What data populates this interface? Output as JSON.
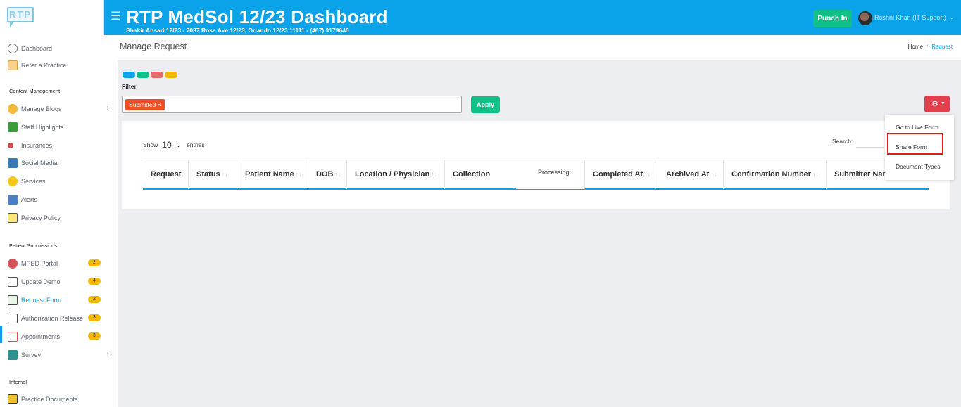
{
  "app": {
    "logo_text": "RTP",
    "title": "RTP MedSol 12/23 Dashboard",
    "subtitle": "Shakir Ansari 12/23 - 7037 Rose Ave 12/23, Orlando 12/23 11111 - (407) 9179646",
    "punch_in_label": "Punch In",
    "user_name": "Roshni Khan (IT Support)"
  },
  "sidebar": {
    "items": [
      {
        "label": "Dashboard",
        "icon": "dashboard-icon"
      },
      {
        "label": "Refer a Practice",
        "icon": "refer-icon"
      }
    ],
    "content_section": "Content Management",
    "content_items": [
      {
        "label": "Manage Blogs",
        "icon": "blog-icon"
      },
      {
        "label": "Staff Highlights",
        "icon": "staff-icon"
      },
      {
        "label": "Insurances",
        "icon": "insurance-icon"
      },
      {
        "label": "Social Media",
        "icon": "social-icon"
      },
      {
        "label": "Services",
        "icon": "services-icon"
      },
      {
        "label": "Alerts",
        "icon": "alerts-icon"
      },
      {
        "label": "Privacy Policy",
        "icon": "privacy-icon"
      }
    ],
    "patient_section": "Patient Submissions",
    "patient_items": [
      {
        "label": "MPED Portal",
        "badge": "2"
      },
      {
        "label": "Update Demo",
        "badge": "4"
      },
      {
        "label": "Request Form",
        "badge": "2"
      },
      {
        "label": "Authorization Release",
        "badge": "3"
      },
      {
        "label": "Appointments",
        "badge": "3"
      },
      {
        "label": "Survey"
      }
    ],
    "internal_section": "Internal",
    "internal_items": [
      {
        "label": "Practice Documents"
      }
    ]
  },
  "header": {
    "page_title": "Manage Request",
    "breadcrumb_home": "Home",
    "breadcrumb_current": "Request"
  },
  "filter": {
    "label": "Filter",
    "chip": "Submitted ×",
    "apply_label": "Apply",
    "color_dots": [
      "#0aa2e8",
      "#10c187",
      "#e86a6a",
      "#f5b800"
    ]
  },
  "table": {
    "show_label": "Show",
    "page_size": "10",
    "entries_label": "entries",
    "search_label": "Search:",
    "processing": "Processing...",
    "columns": [
      "Request",
      "Status",
      "Patient Name",
      "DOB",
      "Location / Physician",
      "Collection",
      "Completed At",
      "Archived At",
      "Confirmation Number",
      "Submitter Name"
    ]
  },
  "menu": {
    "items": [
      "Go to Live Form",
      "Share Form",
      "Document Types"
    ]
  }
}
